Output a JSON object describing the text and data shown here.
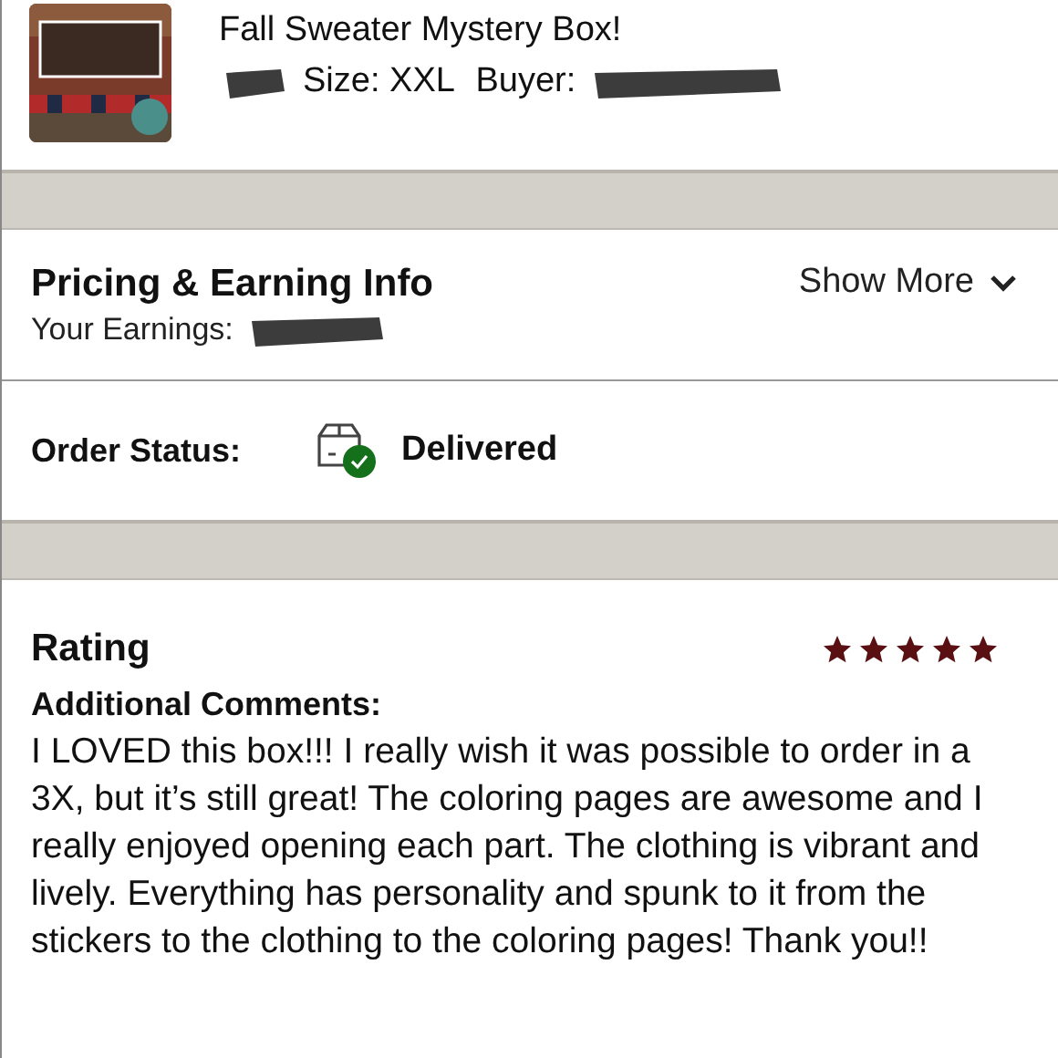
{
  "listing": {
    "title": "Fall Sweater Mystery Box!",
    "size": "Size: XXL",
    "buyer_label": "Buyer:"
  },
  "pricing": {
    "heading": "Pricing & Earning Info",
    "earnings_label": "Your Earnings:",
    "toggle": "Show More",
    "expanded": false
  },
  "order_status": {
    "label": "Order Status:",
    "value": "Delivered"
  },
  "rating": {
    "heading": "Rating",
    "stars": 5
  },
  "comments": {
    "heading": "Additional Comments:",
    "text": "I LOVED this box!!! I really wish it was possible to order in a 3X, but it’s still great! The coloring pages are awesome and I really enjoyed opening each part. The clothing is vibrant and lively. Everything has personality and spunk to it from the stickers to the clothing to the coloring pages! Thank you!!"
  }
}
